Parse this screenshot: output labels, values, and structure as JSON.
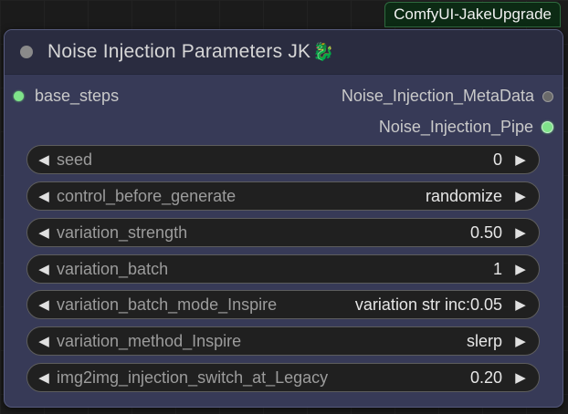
{
  "badge": "ComfyUI-JakeUpgrade",
  "node": {
    "title": "Noise Injection Parameters JK",
    "title_icon": "🐉",
    "inputs": [
      {
        "label": "base_steps"
      }
    ],
    "outputs": [
      {
        "label": "Noise_Injection_MetaData"
      },
      {
        "label": "Noise_Injection_Pipe"
      }
    ],
    "widgets": [
      {
        "label": "seed",
        "value": "0"
      },
      {
        "label": "control_before_generate",
        "value": "randomize"
      },
      {
        "label": "variation_strength",
        "value": "0.50"
      },
      {
        "label": "variation_batch",
        "value": "1"
      },
      {
        "label": "variation_batch_mode_Inspire",
        "value": "variation str inc:0.05"
      },
      {
        "label": "variation_method_Inspire",
        "value": "slerp"
      },
      {
        "label": "img2img_injection_switch_at_Legacy",
        "value": "0.20"
      }
    ],
    "arrow_left": "◀",
    "arrow_right": "▶"
  },
  "colors": {
    "node_body": "#373a57",
    "title_bar": "#2a2c40",
    "badge_bg": "#0c2a14",
    "connected_dot": "#7fe38a"
  }
}
